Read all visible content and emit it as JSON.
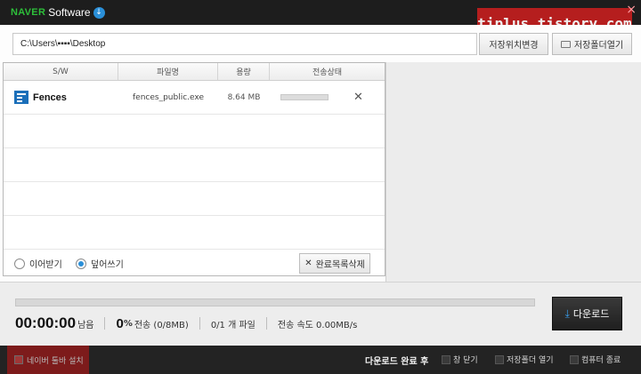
{
  "title_bar": {
    "brand_naver": "NAVER",
    "brand_software": "Software",
    "watermark": "tiplus.tistory.com",
    "close": "×"
  },
  "path_bar": {
    "path_value": "C:\\Users\\▪▪▪▪\\Desktop",
    "change_location_label": "저장위치변경",
    "open_folder_label": "저장폴더열기"
  },
  "list": {
    "columns": [
      "S/W",
      "파일명",
      "용량",
      "전송상태"
    ],
    "rows": [
      {
        "sw": "Fences",
        "file": "fences_public.exe",
        "size": "8.64 MB",
        "progress": 0.0
      }
    ],
    "empty_rows": 4
  },
  "options": {
    "resume_label": "이어받기",
    "overwrite_label": "덮어쓰기",
    "selected": "overwrite",
    "clear_completed_label": "완료목록삭제"
  },
  "status": {
    "overall_progress": 0.0,
    "elapsed_time": "00:00:00",
    "time_suffix": "남음",
    "percent": "0",
    "percent_symbol": "%",
    "transfer_label": "전송 (0/8MB)",
    "files_label": "0/1 개 파일",
    "speed_label": "전송 속도 0.00MB/s",
    "download_button": "다운로드"
  },
  "bottom_bar": {
    "toolbar_install": "네이버 툴바 설치",
    "after_download_label": "다운로드 완료 후",
    "options": [
      "창 닫기",
      "저장폴더 열기",
      "컴퓨터 종료"
    ]
  },
  "colors": {
    "accent_blue": "#2a8fd8",
    "naver_green": "#2dbf3a",
    "watermark_red": "#c11f1f",
    "bar_dark": "#1d1d1d"
  }
}
